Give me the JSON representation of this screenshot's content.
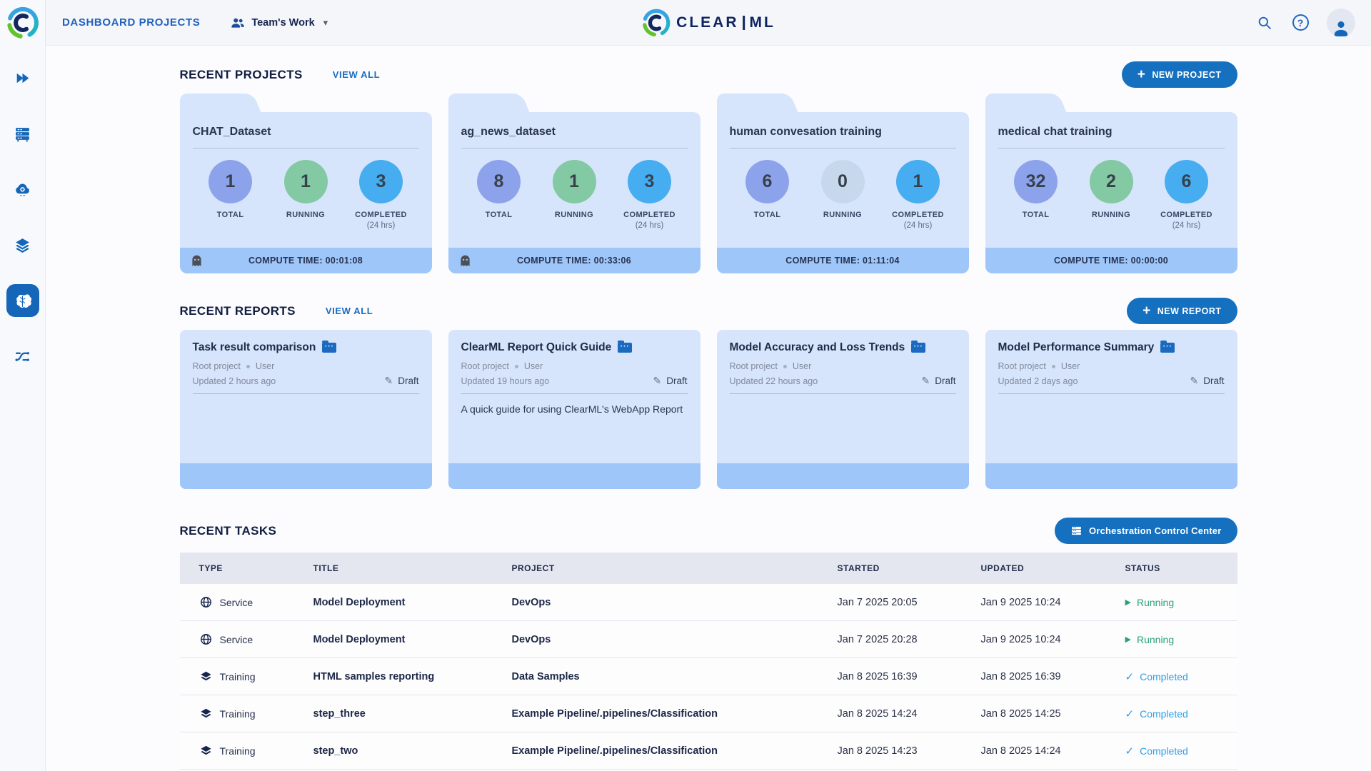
{
  "header": {
    "nav_title": "DASHBOARD PROJECTS",
    "workspace_label": "Team's Work",
    "brand": {
      "part1": "CLEAR",
      "part2": "ML"
    },
    "right_icons": [
      "search-icon",
      "help-icon",
      "user-avatar"
    ]
  },
  "sidebar": {
    "icons": [
      "getting-started-icon",
      "workers-queues-icon",
      "applications-icon",
      "datasets-icon",
      "projects-brain-icon",
      "pipelines-icon"
    ],
    "active": "projects-brain-icon"
  },
  "icons": {
    "plus": "+",
    "pencil": "✎",
    "caret_down": "▾",
    "running_marker": "▶",
    "check": "✓",
    "folder_dots": "···"
  },
  "colors": {
    "accent_blue": "#1570bf",
    "link_blue": "#176dc1",
    "card_body": "#d6e5fc",
    "card_footer": "#9fc6f9",
    "circle_total": "#8ca3ec",
    "circle_running": "#83c9a3",
    "circle_running_zero": "#c7d8ec",
    "circle_completed": "#45adf0",
    "status_running": "#2aa277",
    "status_completed": "#2f9fe6"
  },
  "sections": {
    "projects": {
      "title": "RECENT PROJECTS",
      "view_all": "VIEW ALL",
      "new_button": "NEW PROJECT",
      "stat_labels": {
        "total": "TOTAL",
        "running": "RUNNING",
        "completed": "COMPLETED",
        "completed_sub": "(24 hrs)"
      },
      "cards": [
        {
          "name": "CHAT_Dataset",
          "total": "1",
          "running": "1",
          "completed": "3",
          "compute_time": "COMPUTE TIME: 00:01:08"
        },
        {
          "name": "ag_news_dataset",
          "total": "8",
          "running": "1",
          "completed": "3",
          "compute_time": "COMPUTE TIME: 00:33:06"
        },
        {
          "name": "human convesation training",
          "total": "6",
          "running": "0",
          "completed": "1",
          "compute_time": "COMPUTE TIME: 01:11:04"
        },
        {
          "name": "medical chat training",
          "total": "32",
          "running": "2",
          "completed": "6",
          "compute_time": "COMPUTE TIME: 00:00:00"
        }
      ]
    },
    "reports": {
      "title": "RECENT REPORTS",
      "view_all": "VIEW ALL",
      "new_button": "NEW REPORT",
      "cards": [
        {
          "title": "Task result comparison",
          "project": "Root project",
          "author": "User",
          "updated": "Updated 2 hours ago",
          "status": "Draft",
          "body": ""
        },
        {
          "title": "ClearML Report Quick Guide",
          "project": "Root project",
          "author": "User",
          "updated": "Updated 19 hours ago",
          "status": "Draft",
          "body": "A quick guide for using ClearML's WebApp Report"
        },
        {
          "title": "Model Accuracy and Loss Trends",
          "project": "Root project",
          "author": "User",
          "updated": "Updated 22 hours ago",
          "status": "Draft",
          "body": ""
        },
        {
          "title": "Model Performance Summary",
          "project": "Root project",
          "author": "User",
          "updated": "Updated 2 days ago",
          "status": "Draft",
          "body": ""
        }
      ]
    },
    "tasks": {
      "title": "RECENT TASKS",
      "orchestration_button": "Orchestration Control Center",
      "columns": [
        "TYPE",
        "TITLE",
        "PROJECT",
        "STARTED",
        "UPDATED",
        "STATUS"
      ],
      "rows": [
        {
          "type": "Service",
          "title": "Model Deployment",
          "project": "DevOps",
          "started": "Jan 7 2025 20:05",
          "updated": "Jan 9 2025 10:24",
          "status": "Running"
        },
        {
          "type": "Service",
          "title": "Model Deployment",
          "project": "DevOps",
          "started": "Jan 7 2025 20:28",
          "updated": "Jan 9 2025 10:24",
          "status": "Running"
        },
        {
          "type": "Training",
          "title": "HTML samples reporting",
          "project": "Data Samples",
          "started": "Jan 8 2025 16:39",
          "updated": "Jan 8 2025 16:39",
          "status": "Completed"
        },
        {
          "type": "Training",
          "title": "step_three",
          "project": "Example Pipeline/.pipelines/Classification",
          "started": "Jan 8 2025 14:24",
          "updated": "Jan 8 2025 14:25",
          "status": "Completed"
        },
        {
          "type": "Training",
          "title": "step_two",
          "project": "Example Pipeline/.pipelines/Classification",
          "started": "Jan 8 2025 14:23",
          "updated": "Jan 8 2025 14:24",
          "status": "Completed"
        }
      ]
    }
  }
}
